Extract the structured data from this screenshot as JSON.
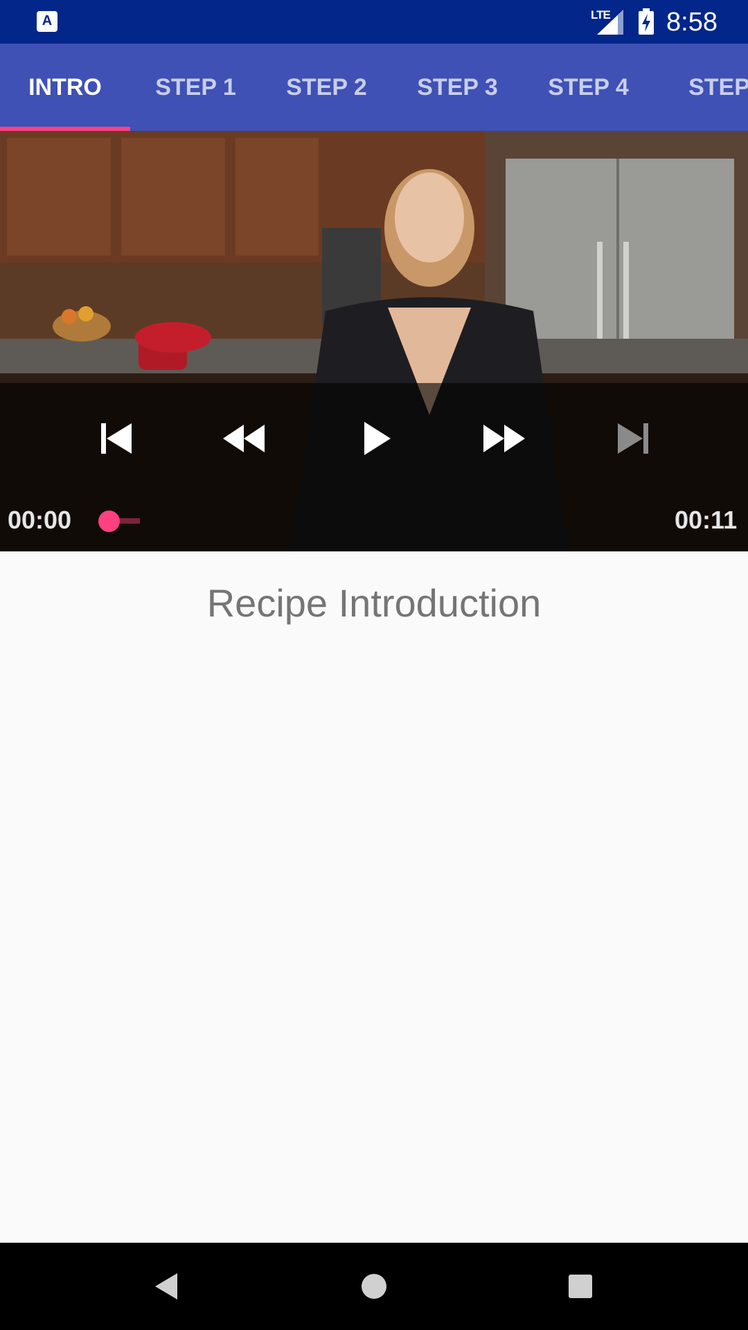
{
  "status_bar": {
    "app_icon_glyph": "A",
    "network": "LTE",
    "time": "8:58"
  },
  "tabs": [
    {
      "label": "INTRO",
      "active": true
    },
    {
      "label": "STEP 1",
      "active": false
    },
    {
      "label": "STEP 2",
      "active": false
    },
    {
      "label": "STEP 3",
      "active": false
    },
    {
      "label": "STEP 4",
      "active": false
    },
    {
      "label": "STEP",
      "active": false
    }
  ],
  "player": {
    "position": "00:00",
    "duration": "00:11",
    "progress": 0.0,
    "icons": [
      "skip-previous-icon",
      "rewind-icon",
      "play-icon",
      "fast-forward-icon",
      "skip-next-icon"
    ]
  },
  "step": {
    "description": "Recipe Introduction"
  },
  "colors": {
    "status_bar": "#02268a",
    "primary": "#3f51b5",
    "accent": "#ff4081",
    "background": "#fafafa"
  }
}
